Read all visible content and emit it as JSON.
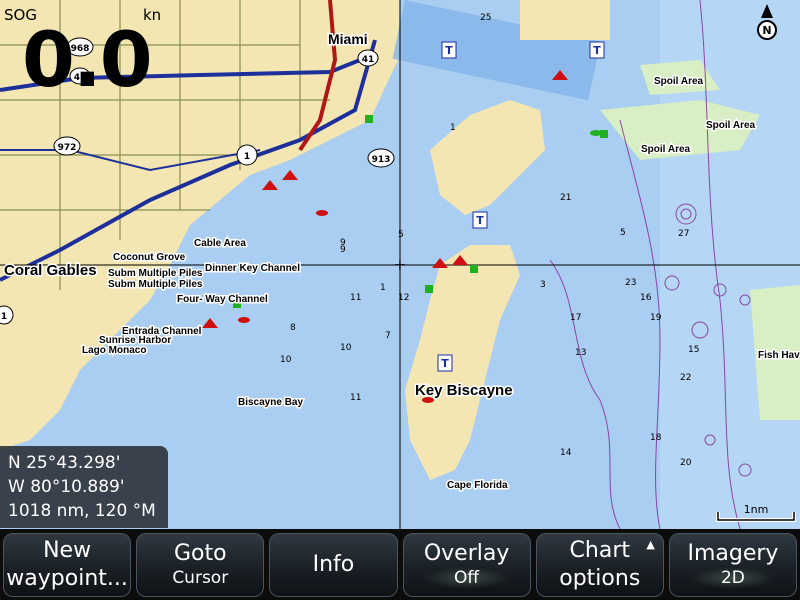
{
  "sog": {
    "label": "SOG",
    "unit": "kn",
    "value": "0.0"
  },
  "position": {
    "lat": "N  25°43.298'",
    "lon": "W  80°10.889'",
    "range": "1018 nm, 120 °M"
  },
  "scale": "1nm",
  "place_labels": {
    "miami": "Miami",
    "coral_gables": "Coral Gables",
    "key_biscayne": "Key Biscayne",
    "biscayne_bay": "Biscayne Bay",
    "cape_florida": "Cape Florida",
    "coconut_grove": "Coconut Grove",
    "cable_area": "Cable Area",
    "dinner_key": "Dinner Key Channel",
    "subm_piles_1": "Subm Multiple Piles",
    "subm_piles_2": "Subm Multiple Piles",
    "four_way": "Four- Way Channel",
    "entrada": "Entrada Channel",
    "sunrise": "Sunrise Harbor",
    "lago_monaco": "Lago Monaco",
    "spoil_1": "Spoil Area",
    "spoil_2": "Spoil Area",
    "spoil_3": "Spoil Area",
    "fish_haven": "Fish Hav"
  },
  "roads": {
    "r968": "968",
    "r41a": "41",
    "r41b": "41",
    "r972": "972",
    "r1": "1",
    "r913": "913",
    "r1b": "1"
  },
  "depths": [
    "25",
    "9",
    "8",
    "1",
    "5",
    "7",
    "3",
    "11",
    "10",
    "9",
    "1",
    "10",
    "5",
    "11",
    "12",
    "23",
    "21",
    "17",
    "27",
    "13",
    "15",
    "16",
    "19",
    "22",
    "20",
    "14",
    "18"
  ],
  "softkeys": {
    "new_waypoint": {
      "line1": "New",
      "line2": "waypoint..."
    },
    "goto": {
      "main": "Goto",
      "sub": "Cursor"
    },
    "info": {
      "main": "Info"
    },
    "overlay": {
      "main": "Overlay",
      "sub": "Off"
    },
    "chart_options": {
      "line1": "Chart",
      "line2": "options"
    },
    "imagery": {
      "main": "Imagery",
      "sub": "2D"
    }
  },
  "colors": {
    "land": "#f3e6b2",
    "shallow": "#97c2ec",
    "deep": "#a8cdf0",
    "road_blue": "#1c2f9a",
    "road_red": "#b01818",
    "green_land": "#d8eec4",
    "contour": "#7a1a8a"
  }
}
